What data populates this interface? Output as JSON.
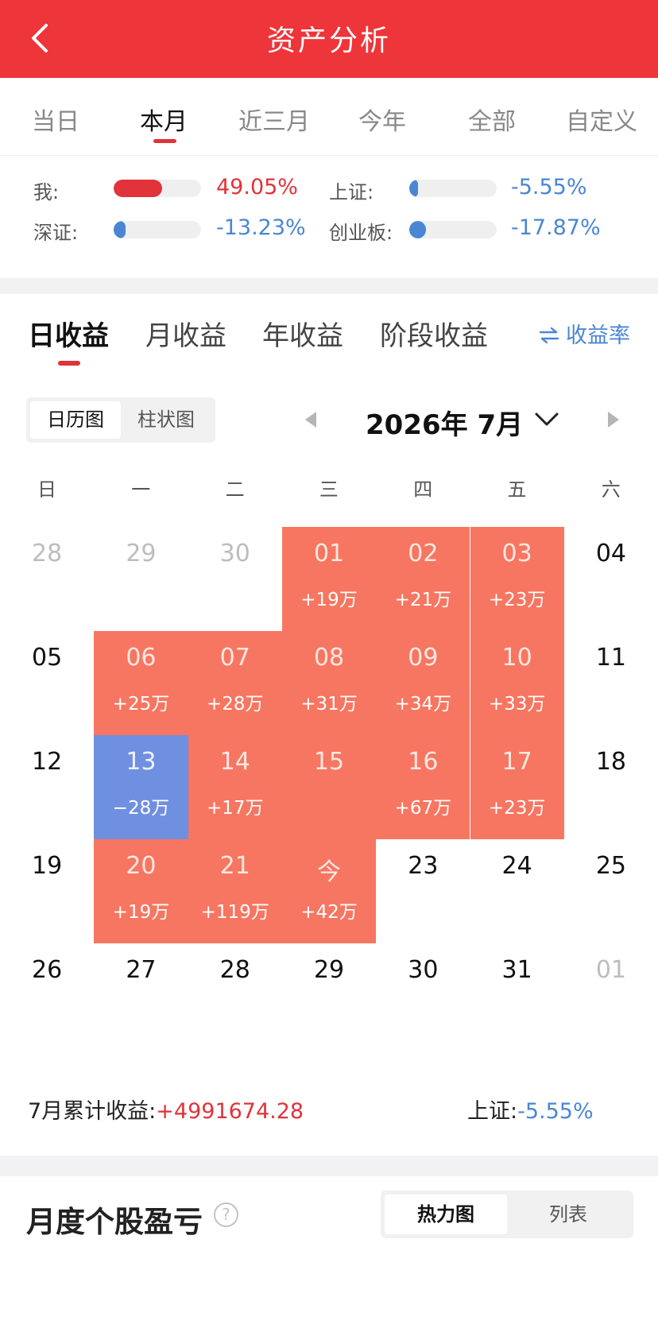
{
  "header": {
    "title": "资产分析",
    "back_icon": "chevron-left-icon"
  },
  "range_tabs": [
    {
      "label": "当日",
      "active": false
    },
    {
      "label": "本月",
      "active": true
    },
    {
      "label": "近三月",
      "active": false
    },
    {
      "label": "今年",
      "active": false
    },
    {
      "label": "全部",
      "active": false
    },
    {
      "label": "自定义",
      "active": false
    }
  ],
  "comparison": {
    "me": {
      "label": "我:",
      "value": "49.05%",
      "fill_fraction": 0.55,
      "color": "#e0333a"
    },
    "shanghai": {
      "label": "上证:",
      "value": "-5.55%",
      "fill_fraction": 0.06,
      "color": "#4a86d4"
    },
    "shenzhen": {
      "label": "深证:",
      "value": "-13.23%",
      "fill_fraction": 0.14,
      "color": "#4a86d4"
    },
    "chinext": {
      "label": "创业板:",
      "value": "-17.87%",
      "fill_fraction": 0.19,
      "color": "#4a86d4"
    }
  },
  "profit_tabs": [
    {
      "label": "日收益",
      "active": true
    },
    {
      "label": "月收益",
      "active": false
    },
    {
      "label": "年收益",
      "active": false
    },
    {
      "label": "阶段收益",
      "active": false
    }
  ],
  "rate_toggle": {
    "label": "收益率",
    "icon": "swap-arrows-icon"
  },
  "view_toggle": {
    "calendar": "日历图",
    "bar": "柱状图",
    "active": "calendar"
  },
  "month_nav": {
    "label": "2026年 7月"
  },
  "weekdays": [
    "日",
    "一",
    "二",
    "三",
    "四",
    "五",
    "六"
  ],
  "calendar": [
    [
      {
        "day": "28",
        "type": "faded"
      },
      {
        "day": "29",
        "type": "faded"
      },
      {
        "day": "30",
        "type": "faded"
      },
      {
        "day": "01",
        "type": "gain",
        "amount": "+19万"
      },
      {
        "day": "02",
        "type": "gain",
        "amount": "+21万"
      },
      {
        "day": "03",
        "type": "gain",
        "amount": "+23万"
      },
      {
        "day": "04",
        "type": "plain"
      }
    ],
    [
      {
        "day": "05",
        "type": "plain"
      },
      {
        "day": "06",
        "type": "gain",
        "amount": "+25万"
      },
      {
        "day": "07",
        "type": "gain",
        "amount": "+28万"
      },
      {
        "day": "08",
        "type": "gain",
        "amount": "+31万"
      },
      {
        "day": "09",
        "type": "gain",
        "amount": "+34万"
      },
      {
        "day": "10",
        "type": "gain",
        "amount": "+33万"
      },
      {
        "day": "11",
        "type": "plain"
      }
    ],
    [
      {
        "day": "12",
        "type": "plain"
      },
      {
        "day": "13",
        "type": "loss",
        "amount": "−28万"
      },
      {
        "day": "14",
        "type": "gain",
        "amount": "+17万"
      },
      {
        "day": "15",
        "type": "gain",
        "amount": ""
      },
      {
        "day": "16",
        "type": "gain",
        "amount": "+67万"
      },
      {
        "day": "17",
        "type": "gain",
        "amount": "+23万"
      },
      {
        "day": "18",
        "type": "plain"
      }
    ],
    [
      {
        "day": "19",
        "type": "plain"
      },
      {
        "day": "20",
        "type": "gain",
        "amount": "+19万"
      },
      {
        "day": "21",
        "type": "gain",
        "amount": "+119万"
      },
      {
        "day": "今",
        "type": "gain",
        "amount": "+42万"
      },
      {
        "day": "23",
        "type": "plain"
      },
      {
        "day": "24",
        "type": "plain"
      },
      {
        "day": "25",
        "type": "plain"
      }
    ],
    [
      {
        "day": "26",
        "type": "plain"
      },
      {
        "day": "27",
        "type": "plain"
      },
      {
        "day": "28",
        "type": "plain"
      },
      {
        "day": "29",
        "type": "plain"
      },
      {
        "day": "30",
        "type": "plain"
      },
      {
        "day": "31",
        "type": "plain"
      },
      {
        "day": "01",
        "type": "faded"
      }
    ]
  ],
  "summary": {
    "cumulative_label": "7月累计收益:",
    "cumulative_value": "+4991674.28",
    "index_label": "上证:",
    "index_value": "-5.55%"
  },
  "stock_section": {
    "title": "月度个股盈亏",
    "help_icon": "question-circle-icon",
    "help_glyph": "?",
    "heatmap": "热力图",
    "list": "列表",
    "active": "heatmap"
  },
  "colors": {
    "brand_red": "#ee3539",
    "gain": "#f77661",
    "loss": "#6f8fe0",
    "blue": "#4a86d4"
  }
}
